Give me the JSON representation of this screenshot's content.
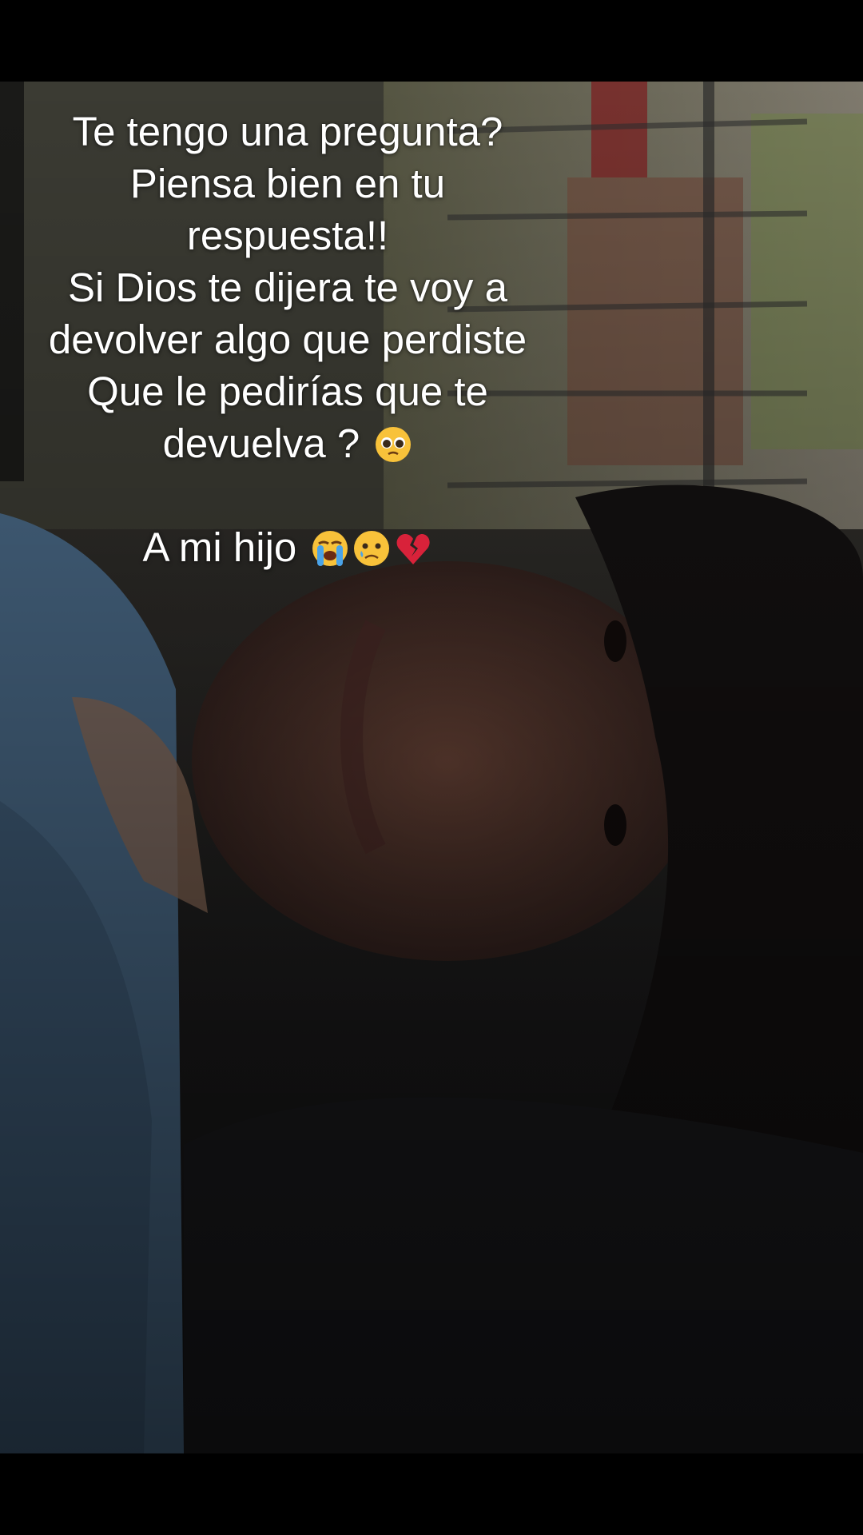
{
  "caption": {
    "lines": [
      "Te tengo una pregunta?",
      "Piensa bien en tu",
      "respuesta!!",
      "Si Dios te dijera te voy a",
      "devolver algo que perdiste",
      "Que le pedirías que te",
      "devuelva ?"
    ],
    "answer": "A mi hijo"
  },
  "emojis": {
    "question_emoji": "pleading-face-emoji",
    "answer_emojis": [
      "loudly-crying-face-emoji",
      "crying-face-emoji",
      "broken-heart-emoji"
    ]
  },
  "colors": {
    "text": "#ffffff",
    "letterbox": "#000000",
    "shirt": "#4a6a88"
  }
}
